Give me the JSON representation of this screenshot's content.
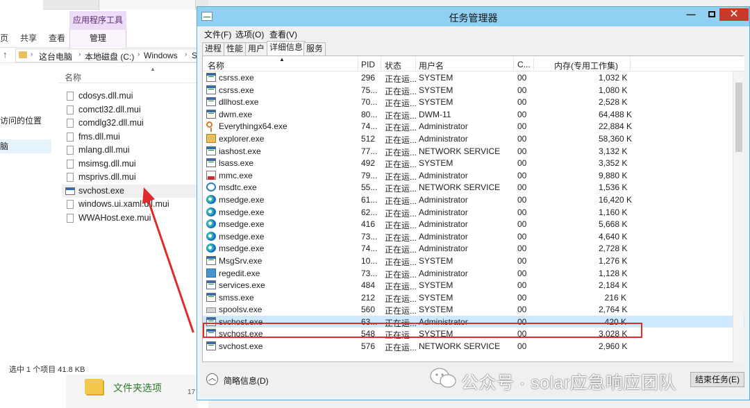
{
  "explorer": {
    "context_tab": "应用程序工具",
    "tabs": [
      "页",
      "共享",
      "查看",
      "管理"
    ],
    "address": [
      "这台电脑",
      "本地磁盘 (C:)",
      "Windows",
      "S"
    ],
    "nav": {
      "locations": "访问的位置",
      "this_pc": "脑"
    },
    "column_name": "名称",
    "files": [
      {
        "name": "cdosys.dll.mui",
        "type": "file"
      },
      {
        "name": "comctl32.dll.mui",
        "type": "file"
      },
      {
        "name": "comdlg32.dll.mui",
        "type": "file"
      },
      {
        "name": "fms.dll.mui",
        "type": "file"
      },
      {
        "name": "mlang.dll.mui",
        "type": "file"
      },
      {
        "name": "msimsg.dll.mui",
        "type": "file"
      },
      {
        "name": "msprivs.dll.mui",
        "type": "file"
      },
      {
        "name": "svchost.exe",
        "type": "exe"
      },
      {
        "name": "windows.ui.xaml.dll.mui",
        "type": "file"
      },
      {
        "name": "WWAHost.exe.mui",
        "type": "file"
      }
    ],
    "status": "选中 1 个项目  41.8 KB",
    "folder_options": "文件夹选项",
    "bottom_num": "17"
  },
  "taskmgr": {
    "title": "任务管理器",
    "menu": [
      "文件(F)",
      "选项(O)",
      "查看(V)"
    ],
    "tabs": [
      "进程",
      "性能",
      "用户",
      "详细信息",
      "服务"
    ],
    "active_tab": "详细信息",
    "columns": {
      "name": "名称",
      "pid": "PID",
      "status": "状态",
      "user": "用户名",
      "cpu": "C...",
      "mem": "内存(专用工作集)"
    },
    "rows": [
      {
        "name": "csrss.exe",
        "pid": "296",
        "status": "正在运...",
        "user": "SYSTEM",
        "cpu": "00",
        "mem": "1,032 K",
        "icon": "exe"
      },
      {
        "name": "csrss.exe",
        "pid": "75...",
        "status": "正在运...",
        "user": "SYSTEM",
        "cpu": "00",
        "mem": "1,080 K",
        "icon": "exe"
      },
      {
        "name": "dllhost.exe",
        "pid": "70...",
        "status": "正在运...",
        "user": "SYSTEM",
        "cpu": "00",
        "mem": "2,528 K",
        "icon": "exe"
      },
      {
        "name": "dwm.exe",
        "pid": "80...",
        "status": "正在运...",
        "user": "DWM-11",
        "cpu": "00",
        "mem": "64,488 K",
        "icon": "exe"
      },
      {
        "name": "Everythingx64.exe",
        "pid": "74...",
        "status": "正在运...",
        "user": "Administrator",
        "cpu": "00",
        "mem": "22,884 K",
        "icon": "key"
      },
      {
        "name": "explorer.exe",
        "pid": "512",
        "status": "正在运...",
        "user": "Administrator",
        "cpu": "00",
        "mem": "58,360 K",
        "icon": "explorer"
      },
      {
        "name": "iashost.exe",
        "pid": "77...",
        "status": "正在运...",
        "user": "NETWORK SERVICE",
        "cpu": "00",
        "mem": "3,132 K",
        "icon": "exe"
      },
      {
        "name": "lsass.exe",
        "pid": "492",
        "status": "正在运...",
        "user": "SYSTEM",
        "cpu": "00",
        "mem": "3,352 K",
        "icon": "exe"
      },
      {
        "name": "mmc.exe",
        "pid": "79...",
        "status": "正在运...",
        "user": "Administrator",
        "cpu": "00",
        "mem": "9,880 K",
        "icon": "mmc"
      },
      {
        "name": "msdtc.exe",
        "pid": "55...",
        "status": "正在运...",
        "user": "NETWORK SERVICE",
        "cpu": "00",
        "mem": "1,536 K",
        "icon": "msdtc"
      },
      {
        "name": "msedge.exe",
        "pid": "61...",
        "status": "正在运...",
        "user": "Administrator",
        "cpu": "00",
        "mem": "16,420 K",
        "icon": "edge"
      },
      {
        "name": "msedge.exe",
        "pid": "62...",
        "status": "正在运...",
        "user": "Administrator",
        "cpu": "00",
        "mem": "1,160 K",
        "icon": "edge"
      },
      {
        "name": "msedge.exe",
        "pid": "416",
        "status": "正在运...",
        "user": "Administrator",
        "cpu": "00",
        "mem": "5,668 K",
        "icon": "edge"
      },
      {
        "name": "msedge.exe",
        "pid": "73...",
        "status": "正在运...",
        "user": "Administrator",
        "cpu": "00",
        "mem": "4,640 K",
        "icon": "edge"
      },
      {
        "name": "msedge.exe",
        "pid": "74...",
        "status": "正在运...",
        "user": "Administrator",
        "cpu": "00",
        "mem": "2,728 K",
        "icon": "edge"
      },
      {
        "name": "MsgSrv.exe",
        "pid": "10...",
        "status": "正在运...",
        "user": "SYSTEM",
        "cpu": "00",
        "mem": "1,276 K",
        "icon": "exe"
      },
      {
        "name": "regedit.exe",
        "pid": "73...",
        "status": "正在运...",
        "user": "Administrator",
        "cpu": "00",
        "mem": "1,128 K",
        "icon": "regedit"
      },
      {
        "name": "services.exe",
        "pid": "484",
        "status": "正在运...",
        "user": "SYSTEM",
        "cpu": "00",
        "mem": "2,184 K",
        "icon": "exe"
      },
      {
        "name": "smss.exe",
        "pid": "212",
        "status": "正在运...",
        "user": "SYSTEM",
        "cpu": "00",
        "mem": "216 K",
        "icon": "exe"
      },
      {
        "name": "spoolsv.exe",
        "pid": "560",
        "status": "正在运...",
        "user": "SYSTEM",
        "cpu": "00",
        "mem": "2,764 K",
        "icon": "spool"
      },
      {
        "name": "svchost.exe",
        "pid": "63...",
        "status": "正在运...",
        "user": "Administrator",
        "cpu": "00",
        "mem": "420 K",
        "icon": "exe",
        "highlight": true
      },
      {
        "name": "svchost.exe",
        "pid": "548",
        "status": "正在运...",
        "user": "SYSTEM",
        "cpu": "00",
        "mem": "3,028 K",
        "icon": "exe"
      },
      {
        "name": "svchost.exe",
        "pid": "576",
        "status": "正在运...",
        "user": "NETWORK SERVICE",
        "cpu": "00",
        "mem": "2,960 K",
        "icon": "exe"
      }
    ],
    "less_details": "简略信息(D)",
    "end_task": "结束任务(E)"
  },
  "watermark": "公众号 · solar应急响应团队",
  "colors": {
    "title_bar": "#8fd0f3",
    "highlight_box": "#e12a2a",
    "arrow": "#e12a2a",
    "selected_row": "#cde8ff"
  }
}
